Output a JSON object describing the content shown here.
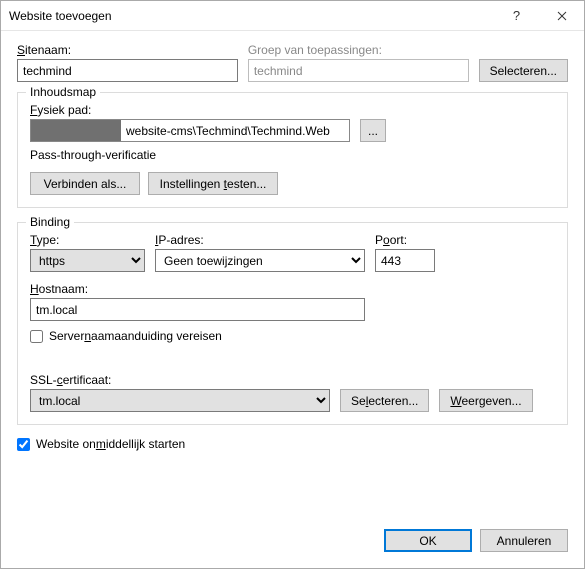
{
  "window": {
    "title": "Website toevoegen"
  },
  "siteRow": {
    "siteLabel": "Sitenaam:",
    "siteValue": "techmind",
    "poolLabel": "Groep van toepassingen:",
    "poolValue": "techmind",
    "selectBtn": "Selecteren..."
  },
  "content": {
    "groupTitle": "Inhoudsmap",
    "physPathLabel": "Fysiek pad:",
    "physPathValue": "website-cms\\Techmind\\Techmind.Web",
    "browseBtn": "...",
    "passThrough": "Pass-through-verificatie",
    "connectAs": "Verbinden als...",
    "testSettings": "Instellingen testen..."
  },
  "binding": {
    "groupTitle": "Binding",
    "typeLabel": "Type:",
    "typeValue": "https",
    "ipLabel": "IP-adres:",
    "ipValue": "Geen toewijzingen",
    "portLabel": "Poort:",
    "portValue": "443",
    "hostLabel": "Hostnaam:",
    "hostValue": "tm.local",
    "sniLabel": "Servernaamaanduiding vereisen",
    "sslLabel": "SSL-certificaat:",
    "sslValue": "tm.local",
    "sslSelect": "Selecteren...",
    "sslView": "Weergeven..."
  },
  "startNow": "Website onmiddellijk starten",
  "footer": {
    "ok": "OK",
    "cancel": "Annuleren"
  }
}
